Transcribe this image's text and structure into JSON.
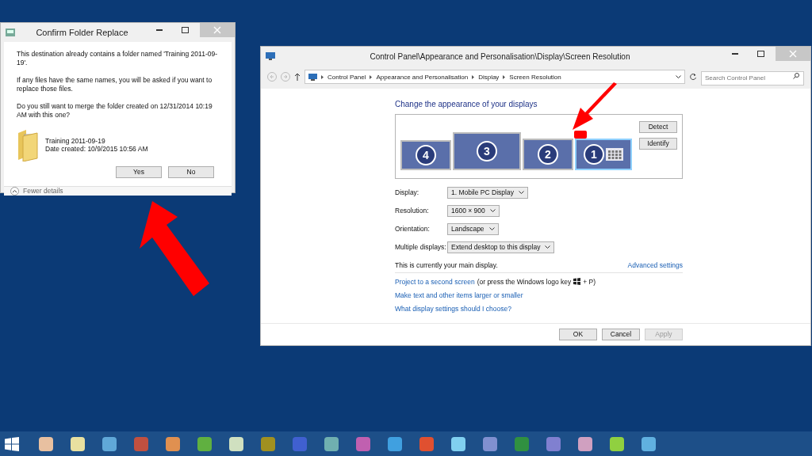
{
  "dialog": {
    "title": "Confirm Folder Replace",
    "messages": [
      "This destination already contains a folder named 'Training 2011-09-19'.",
      "If any files have the same names, you will be asked if you want to replace those files.",
      "Do you still want to merge the folder created on 12/31/2014 10:19 AM with this one?"
    ],
    "folder_name": "Training 2011-09-19",
    "folder_date": "Date created: 10/9/2015 10:56 AM",
    "buttons": [
      "Yes",
      "No"
    ],
    "details_toggle": "Fewer details"
  },
  "control_panel": {
    "title": "Control Panel\\Appearance and Personalisation\\Display\\Screen Resolution",
    "breadcrumb": [
      "Control Panel",
      "Appearance and Personalisation",
      "Display",
      "Screen Resolution"
    ],
    "search": {
      "placeholder": "Search Control Panel"
    },
    "heading": "Change the appearance of your displays",
    "monitors": [
      {
        "number": "4",
        "selected": false
      },
      {
        "number": "3",
        "selected": false
      },
      {
        "number": "2",
        "selected": false
      },
      {
        "number": "1",
        "selected": true
      }
    ],
    "monitor_buttons": [
      "Detect",
      "Identify"
    ],
    "settings": [
      {
        "label": "Display:",
        "value": "1. Mobile PC Display"
      },
      {
        "label": "Resolution:",
        "value": "1600 × 900"
      },
      {
        "label": "Orientation:",
        "value": "Landscape"
      },
      {
        "label": "Multiple displays:",
        "value": "Extend desktop to this display"
      }
    ],
    "main_note": "This is currently your main display.",
    "advanced_link": "Advanced settings",
    "project_link": "Project to a second screen",
    "project_hint_before": "(or press the Windows logo key",
    "project_hint_after": "+ P)",
    "links": [
      "Make text and other items larger or smaller",
      "What display settings should I choose?"
    ],
    "buttons": [
      {
        "label": "OK",
        "disabled": false
      },
      {
        "label": "Cancel",
        "disabled": false
      },
      {
        "label": "Apply",
        "disabled": true
      }
    ]
  },
  "taskbar": {
    "apps": [
      {
        "color": "#e8c0a0"
      },
      {
        "color": "#e8e0a0"
      },
      {
        "color": "#60a8d8"
      },
      {
        "color": "#c05040"
      },
      {
        "color": "#e09050"
      },
      {
        "color": "#60b040"
      },
      {
        "color": "#d0e0c0"
      },
      {
        "color": "#a09020"
      },
      {
        "color": "#4060d0"
      },
      {
        "color": "#70b0b0"
      },
      {
        "color": "#c060b0"
      },
      {
        "color": "#40a0e0"
      },
      {
        "color": "#e05030"
      },
      {
        "color": "#80d0f0"
      },
      {
        "color": "#8090d0"
      },
      {
        "color": "#309040"
      },
      {
        "color": "#8080d0"
      },
      {
        "color": "#d0a0c0"
      },
      {
        "color": "#90d040"
      },
      {
        "color": "#60b0e0"
      }
    ]
  }
}
